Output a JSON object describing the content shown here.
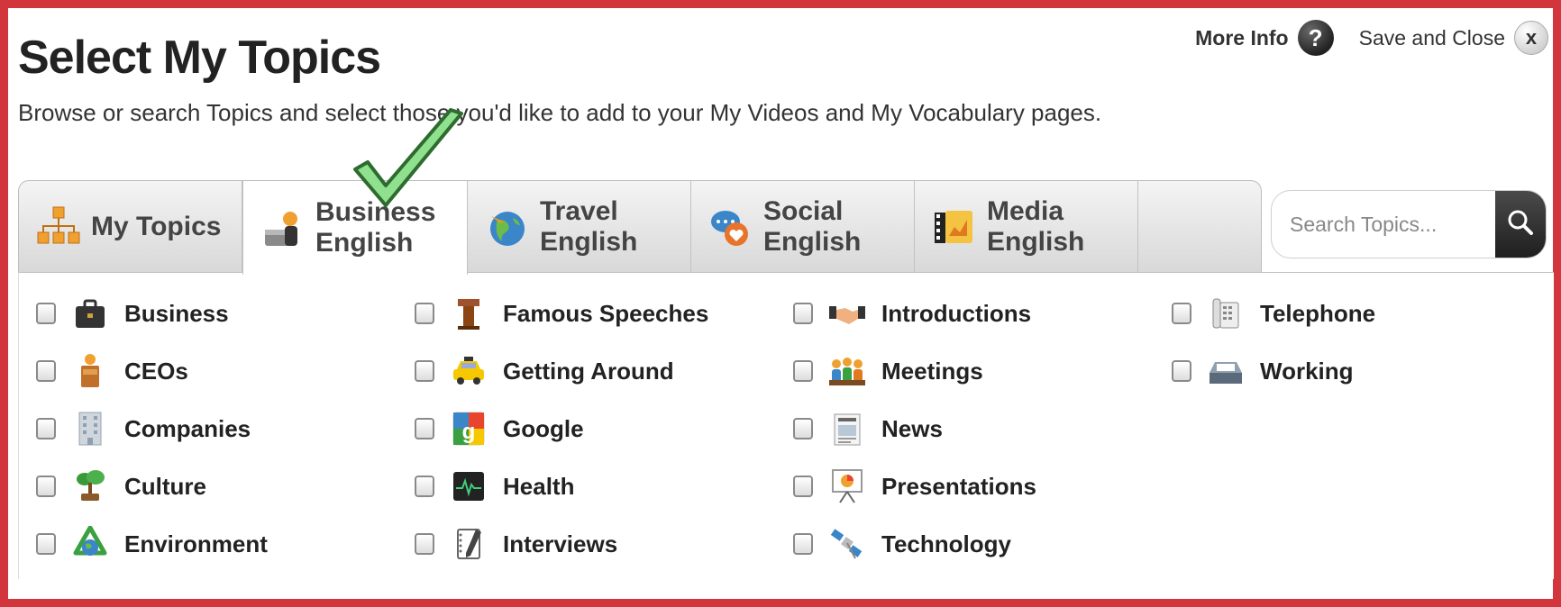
{
  "page": {
    "title": "Select My Topics",
    "subtitle": "Browse or search Topics and select those you'd like to add to your My Videos and My Vocabulary pages."
  },
  "actions": {
    "more_info": "More Info",
    "more_info_icon": "?",
    "save_and_close": "Save and Close",
    "close_icon": "x"
  },
  "tabs": [
    {
      "label": "My Topics",
      "icon": "org-chart-icon",
      "active": false
    },
    {
      "label": "Business English",
      "icon": "business-icon",
      "active": true
    },
    {
      "label": "Travel English",
      "icon": "globe-icon",
      "active": false
    },
    {
      "label": "Social English",
      "icon": "chat-bubbles-icon",
      "active": false
    },
    {
      "label": "Media English",
      "icon": "film-icon",
      "active": false
    }
  ],
  "search": {
    "placeholder": "Search Topics..."
  },
  "topics": [
    {
      "label": "Business",
      "icon": "briefcase-icon"
    },
    {
      "label": "CEOs",
      "icon": "podium-icon"
    },
    {
      "label": "Companies",
      "icon": "building-icon"
    },
    {
      "label": "Culture",
      "icon": "bonsai-icon"
    },
    {
      "label": "Environment",
      "icon": "recycle-globe-icon"
    },
    {
      "label": "Famous Speeches",
      "icon": "lectern-icon"
    },
    {
      "label": "Getting Around",
      "icon": "taxi-icon"
    },
    {
      "label": "Google",
      "icon": "google-icon"
    },
    {
      "label": "Health",
      "icon": "heart-monitor-icon"
    },
    {
      "label": "Interviews",
      "icon": "notepad-icon"
    },
    {
      "label": "Introductions",
      "icon": "handshake-icon"
    },
    {
      "label": "Meetings",
      "icon": "people-icon"
    },
    {
      "label": "News",
      "icon": "newspaper-icon"
    },
    {
      "label": "Presentations",
      "icon": "presentation-board-icon"
    },
    {
      "label": "Technology",
      "icon": "satellite-icon"
    },
    {
      "label": "Telephone",
      "icon": "phone-icon"
    },
    {
      "label": "Working",
      "icon": "inbox-tray-icon"
    }
  ],
  "colors": {
    "frame": "#d3353d",
    "checkmark": "#7fd17f"
  }
}
